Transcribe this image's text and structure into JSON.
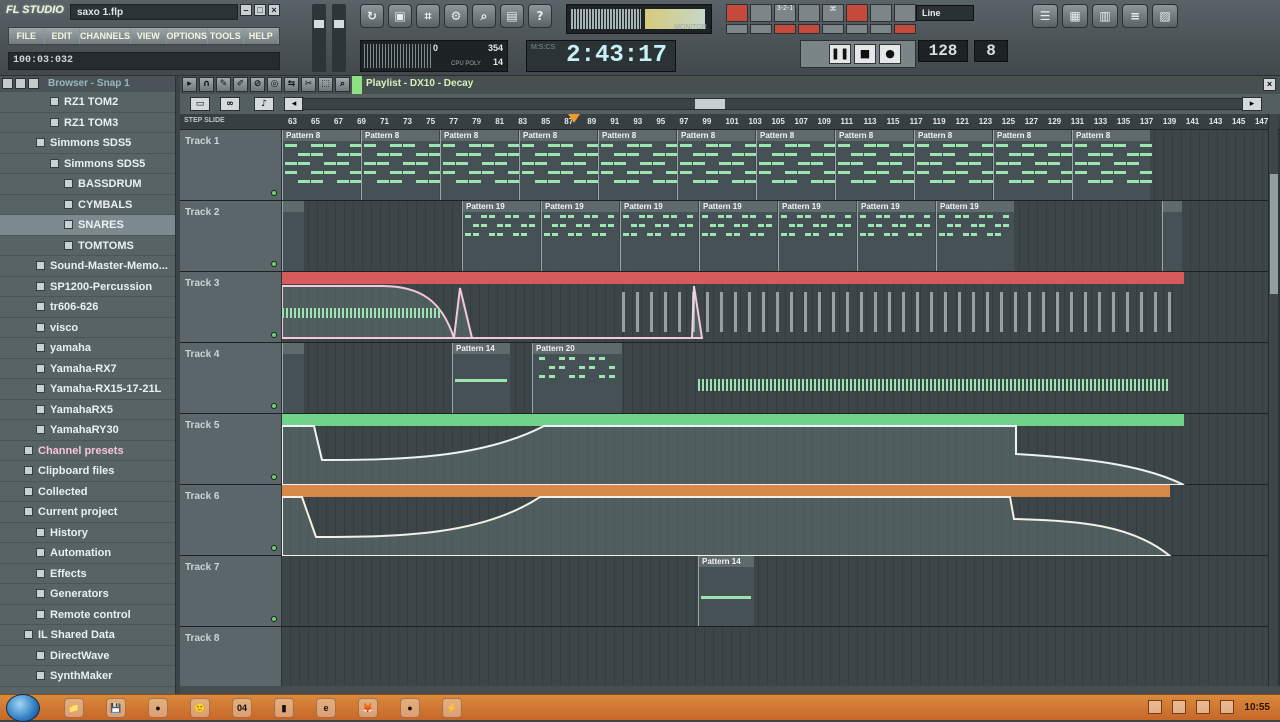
{
  "app": {
    "logo": "FL STUDIO",
    "filename": "saxo 1.flp",
    "menus": [
      "FILE",
      "EDIT",
      "CHANNELS",
      "VIEW",
      "OPTIONS",
      "TOOLS",
      "HELP"
    ],
    "song_position": "100:03:032"
  },
  "toolbar": {
    "cpu": {
      "value": "0",
      "poly": "354",
      "poly2": "14",
      "label": "CPU  POLY"
    },
    "time": "2:43:17",
    "time_label": "M:S:CS",
    "line_mode": "Line",
    "tempo": "128",
    "pattern": "8",
    "monitor_label": "MONITOR",
    "toolset_icons": [
      "↻",
      "▣",
      "⌗",
      "⚙",
      "⌕",
      "▤",
      "?"
    ],
    "right_icons": [
      "☰",
      "▦",
      "▥",
      "≡",
      "▨"
    ],
    "transport": [
      "❚❚",
      "■",
      "●"
    ],
    "mini_grid": [
      "",
      "",
      "3-2-1",
      "",
      "⌘",
      "",
      "",
      "",
      "",
      "",
      "",
      "",
      "",
      "",
      "",
      ""
    ]
  },
  "browser": {
    "title": "Browser - Snap 1",
    "items": [
      {
        "label": "RZ1 TOM2",
        "indent": 50
      },
      {
        "label": "RZ1 TOM3",
        "indent": 50
      },
      {
        "label": "Simmons SDS5",
        "indent": 36
      },
      {
        "label": "Simmons SDS5",
        "indent": 50
      },
      {
        "label": "BASSDRUM",
        "indent": 64
      },
      {
        "label": "CYMBALS",
        "indent": 64
      },
      {
        "label": "SNARES",
        "indent": 64,
        "selected": true
      },
      {
        "label": "TOMTOMS",
        "indent": 64
      },
      {
        "label": "Sound-Master-Memo...",
        "indent": 36
      },
      {
        "label": "SP1200-Percussion",
        "indent": 36
      },
      {
        "label": "tr606-626",
        "indent": 36
      },
      {
        "label": "visco",
        "indent": 36
      },
      {
        "label": "yamaha",
        "indent": 36
      },
      {
        "label": "Yamaha-RX7",
        "indent": 36
      },
      {
        "label": "Yamaha-RX15-17-21L",
        "indent": 36
      },
      {
        "label": "YamahaRX5",
        "indent": 36
      },
      {
        "label": "YamahaRY30",
        "indent": 36
      },
      {
        "label": "Channel presets",
        "indent": 24,
        "pink": true
      },
      {
        "label": "Clipboard files",
        "indent": 24
      },
      {
        "label": "Collected",
        "indent": 24
      },
      {
        "label": "Current project",
        "indent": 24
      },
      {
        "label": "History",
        "indent": 36
      },
      {
        "label": "Automation",
        "indent": 36
      },
      {
        "label": "Effects",
        "indent": 36
      },
      {
        "label": "Generators",
        "indent": 36
      },
      {
        "label": "Remote control",
        "indent": 36
      },
      {
        "label": "IL Shared Data",
        "indent": 24
      },
      {
        "label": "DirectWave",
        "indent": 36
      },
      {
        "label": "SynthMaker",
        "indent": 36
      }
    ]
  },
  "playlist": {
    "title": "Playlist - DX10 - Decay",
    "snap_labels": "STEP  SLIDE",
    "ruler": [
      "63",
      "65",
      "67",
      "69",
      "71",
      "73",
      "75",
      "77",
      "79",
      "81",
      "83",
      "85",
      "87",
      "89",
      "91",
      "93",
      "95",
      "97",
      "99",
      "101",
      "103",
      "105",
      "107",
      "109",
      "111",
      "113",
      "115",
      "117",
      "119",
      "121",
      "123",
      "125",
      "127",
      "129",
      "131",
      "133",
      "135",
      "137",
      "139",
      "141",
      "143",
      "145",
      "147"
    ],
    "tracks": [
      {
        "name": "Track 1"
      },
      {
        "name": "Track 2"
      },
      {
        "name": "Track 3"
      },
      {
        "name": "Track 4"
      },
      {
        "name": "Track 5"
      },
      {
        "name": "Track 6"
      },
      {
        "name": "Track 7"
      },
      {
        "name": "Track 8"
      }
    ],
    "clip_labels": {
      "p8": "Pattern 8",
      "p19": "Pattern 19",
      "p14": "Pattern 14",
      "p20": "Pattern 20"
    },
    "colors": {
      "green_auto": "#6fd38a",
      "red_auto": "#d65b5b",
      "orange_auto": "#d7894a",
      "note": "#9de5b0"
    }
  },
  "taskbar": {
    "icons": [
      "📁",
      "💾",
      "●",
      "🙂",
      "04",
      "▮",
      "e",
      "🦊",
      "●",
      "⚡"
    ],
    "clock": "10:55"
  }
}
